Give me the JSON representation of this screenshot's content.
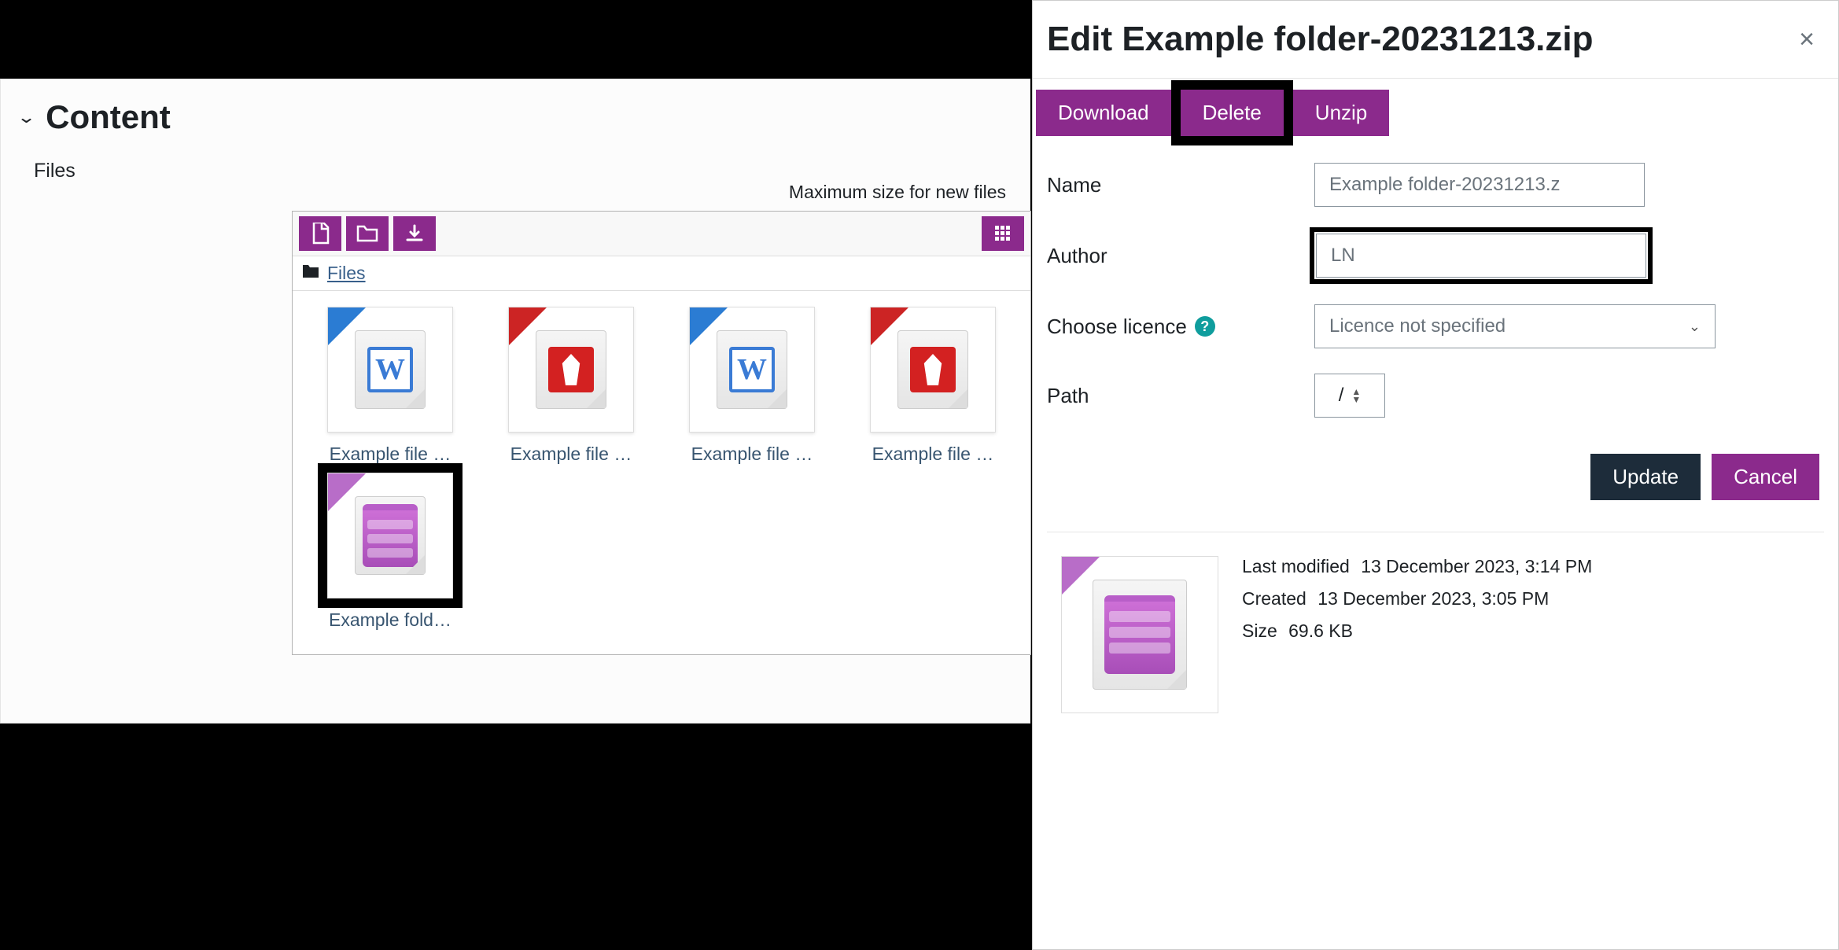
{
  "section": {
    "title": "Content",
    "files_label": "Files",
    "max_size_text": "Maximum size for new files",
    "breadcrumb": "Files"
  },
  "toolbar": {
    "add_file": "add-file",
    "add_folder": "add-folder",
    "download": "download",
    "view_grid": "grid-view"
  },
  "files": [
    {
      "name": "Example file …",
      "type": "word",
      "badge": "badge-blue"
    },
    {
      "name": "Example file …",
      "type": "pdf",
      "badge": "badge-red"
    },
    {
      "name": "Example file …",
      "type": "word",
      "badge": "badge-blue"
    },
    {
      "name": "Example file …",
      "type": "pdf",
      "badge": "badge-red"
    },
    {
      "name": "Example fold…",
      "type": "zip",
      "badge": "badge-purple",
      "selected": true
    }
  ],
  "dialog": {
    "title": "Edit Example folder-20231213.zip",
    "actions": {
      "download": "Download",
      "delete": "Delete",
      "unzip": "Unzip"
    },
    "fields": {
      "name_label": "Name",
      "name_value": "Example folder-20231213.z",
      "author_label": "Author",
      "author_value": "LN",
      "licence_label": "Choose licence",
      "licence_value": "Licence not specified",
      "path_label": "Path",
      "path_value": "/"
    },
    "buttons": {
      "update": "Update",
      "cancel": "Cancel"
    },
    "meta": {
      "last_modified_label": "Last modified",
      "last_modified_value": "13 December 2023, 3:14 PM",
      "created_label": "Created",
      "created_value": "13 December 2023, 3:05 PM",
      "size_label": "Size",
      "size_value": "69.6 KB"
    }
  }
}
